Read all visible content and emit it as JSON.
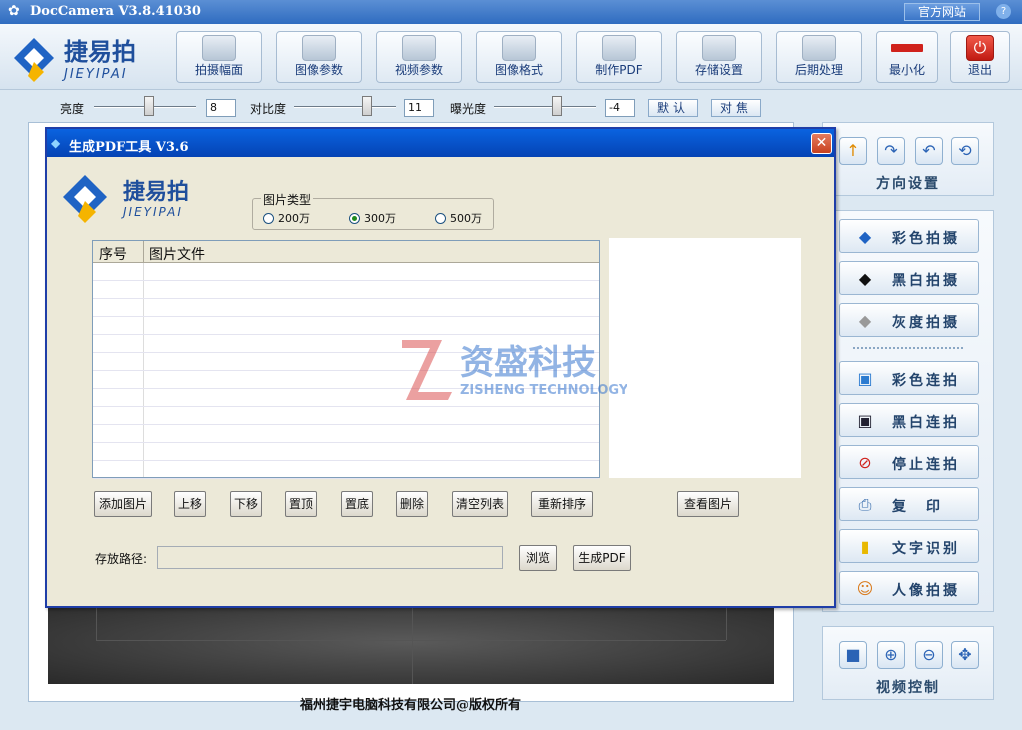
{
  "window": {
    "title": "DocCamera V3.8.41030",
    "site_button": "官方网站",
    "help": "?"
  },
  "toolbar": {
    "items": [
      "拍摄幅面",
      "图像参数",
      "视频参数",
      "图像格式",
      "制作PDF",
      "存储设置",
      "后期处理",
      "最小化",
      "退出"
    ]
  },
  "brand": {
    "cn": "捷易拍",
    "en": "JIEYIPAI"
  },
  "sliders": {
    "brightness_label": "亮度",
    "brightness_value": "8",
    "contrast_label": "对比度",
    "contrast_value": "11",
    "exposure_label": "曝光度",
    "exposure_value": "-4",
    "default_button": "默认",
    "focus_button": "对焦"
  },
  "direction_panel": {
    "title": "方向设置"
  },
  "capture_buttons": [
    "彩色拍摄",
    "黑白拍摄",
    "灰度拍摄"
  ],
  "continuous_buttons": [
    "彩色连拍",
    "黑白连拍",
    "停止连拍",
    "复　印",
    "文字识别",
    "人像拍摄"
  ],
  "video_panel": {
    "title": "视频控制"
  },
  "copyright": "福州捷宇电脑科技有限公司@版权所有",
  "dialog": {
    "title": "生成PDF工具 V3.6",
    "image_type_caption": "图片类型",
    "radios": [
      "200万",
      "300万",
      "500万"
    ],
    "selected_radio": "300万",
    "list_headers": [
      "序号",
      "图片文件"
    ],
    "buttons": [
      "添加图片",
      "上移",
      "下移",
      "置顶",
      "置底",
      "删除",
      "清空列表",
      "重新排序"
    ],
    "view_button": "查看图片",
    "path_label": "存放路径:",
    "path_value": "",
    "browse_button": "浏览",
    "generate_button": "生成PDF"
  },
  "watermark": {
    "cn": "资盛科技",
    "en": "ZISHENG TECHNOLOGY"
  },
  "colors": {
    "title_bar": "#2f6cc0",
    "dialog_title": "#0543b4",
    "accent_red": "#d0221c"
  }
}
